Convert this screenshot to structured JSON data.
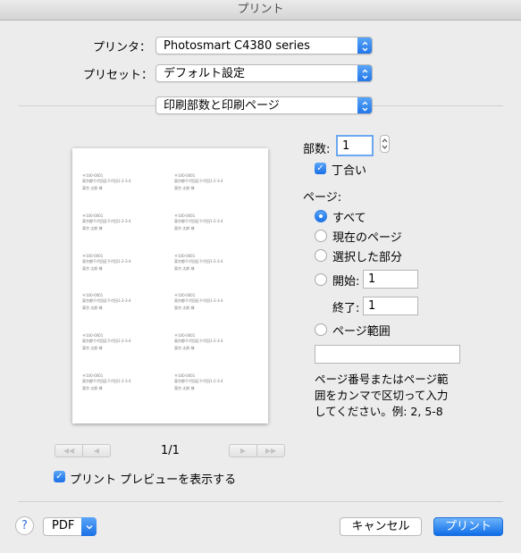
{
  "window": {
    "title": "プリント"
  },
  "printer": {
    "label": "プリンタ：",
    "value": "Photosmart C4380 series"
  },
  "preset": {
    "label": "プリセット：",
    "value": "デフォルト設定"
  },
  "section_popup": {
    "value": "印刷部数と印刷ページ"
  },
  "preview": {
    "labels": [
      {
        "zip": "〒100-0001",
        "address": "東京都千代田区千代田1-2-3-4",
        "name": "東京 太郎 様"
      },
      {
        "zip": "〒100-0001",
        "address": "東京都千代田区千代田1-2-3-4",
        "name": "東京 太郎 様"
      },
      {
        "zip": "〒100-0001",
        "address": "東京都千代田区千代田1-2-3-4",
        "name": "東京 太郎 様"
      },
      {
        "zip": "〒100-0001",
        "address": "東京都千代田区千代田1-2-3-4",
        "name": "東京 太郎 様"
      },
      {
        "zip": "〒100-0001",
        "address": "東京都千代田区千代田1-2-3-4",
        "name": "東京 太郎 様"
      },
      {
        "zip": "〒100-0001",
        "address": "東京都千代田区千代田1-2-3-4",
        "name": "東京 太郎 様"
      },
      {
        "zip": "〒100-0001",
        "address": "東京都千代田区千代田1-2-3-4",
        "name": "東京 太郎 様"
      },
      {
        "zip": "〒100-0001",
        "address": "東京都千代田区千代田1-2-3-4",
        "name": "東京 太郎 様"
      },
      {
        "zip": "〒100-0001",
        "address": "東京都千代田区千代田1-2-3-4",
        "name": "東京 太郎 様"
      },
      {
        "zip": "〒100-0001",
        "address": "東京都千代田区千代田1-2-3-4",
        "name": "東京 太郎 様"
      },
      {
        "zip": "〒100-0001",
        "address": "東京都千代田区千代田1-2-3-4",
        "name": "東京 太郎 様"
      },
      {
        "zip": "〒100-0001",
        "address": "東京都千代田区千代田1-2-3-4",
        "name": "東京 太郎 様"
      }
    ],
    "page_indicator": "1/1"
  },
  "copies": {
    "label": "部数:",
    "value": "1",
    "collate_label": "丁合い",
    "collate_checked": true
  },
  "pages": {
    "label": "ページ:",
    "options": [
      "すべて",
      "現在のページ",
      "選択した部分"
    ],
    "selected": "すべて",
    "from_label": "開始:",
    "from_value": "1",
    "to_label": "終了:",
    "to_value": "1",
    "range_label": "ページ範囲",
    "range_value": "",
    "hint_lines": [
      "ページ番号またはページ範",
      "囲をカンマで区切って入力",
      "してください。例: 2, 5-8"
    ]
  },
  "show_preview": {
    "label": "プリント プレビューを表示する",
    "checked": true
  },
  "footer": {
    "help": "?",
    "pdf": "PDF",
    "cancel": "キャンセル",
    "print": "プリント"
  },
  "colors": {
    "accent": "#1a6fe6",
    "window_bg": "#ececec"
  }
}
